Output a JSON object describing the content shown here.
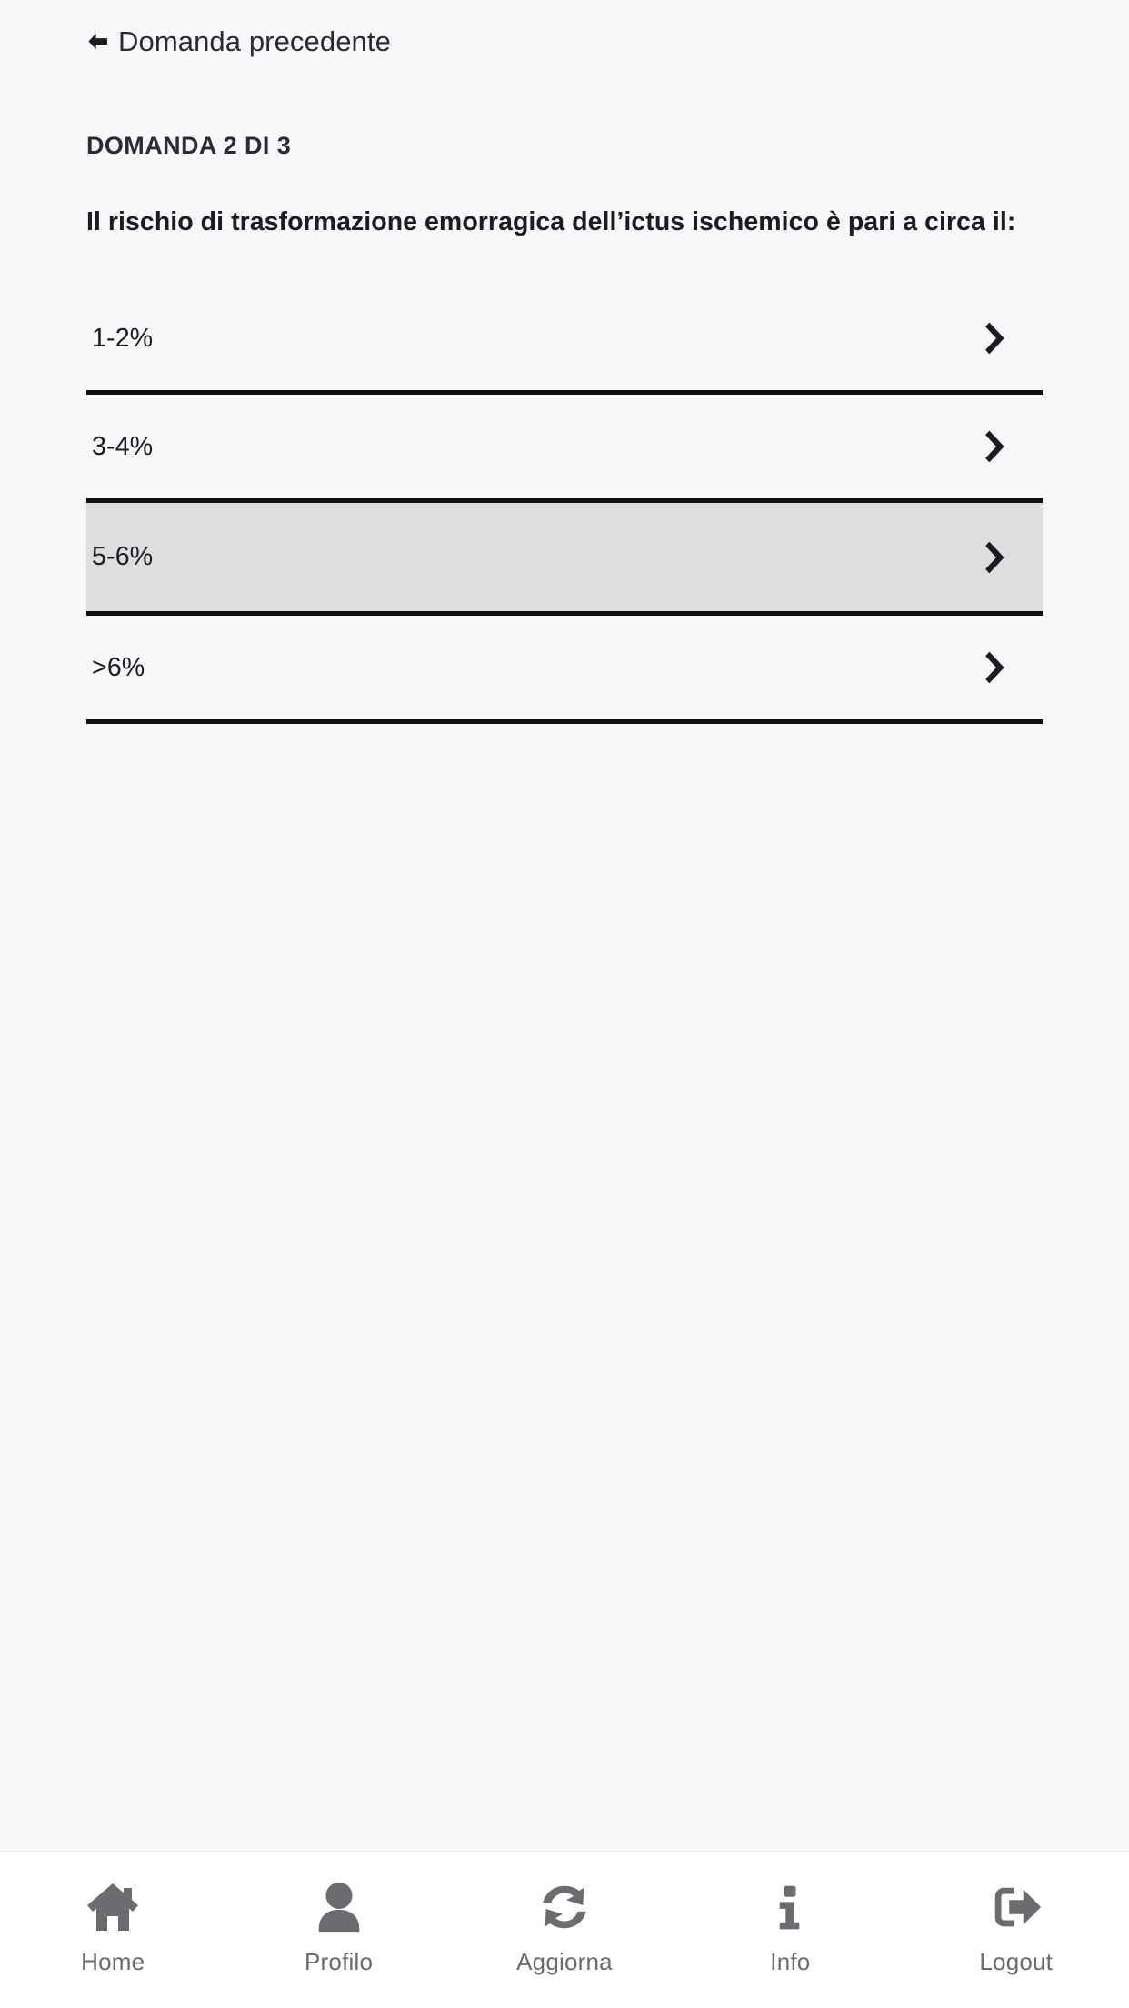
{
  "colors": {
    "page_background": "#f8f7fa",
    "nav_background": "#ffffff",
    "text_primary": "#1c1c20",
    "selected_row_background": "#dedde0",
    "row_border": "#111114",
    "nav_icon": "#6b6b70",
    "nav_label": "#6b6b70"
  },
  "back": {
    "label": "Domanda precedente",
    "icon": "arrow-left-icon"
  },
  "question": {
    "counter": "DOMANDA 2 DI 3",
    "text": "Il rischio di trasformazione emorragica dell’ictus ischemico è pari a circa il:"
  },
  "answers": [
    {
      "label": "1-2%",
      "selected": false,
      "chevron": "chevron-right-icon"
    },
    {
      "label": "3-4%",
      "selected": false,
      "chevron": "chevron-right-icon"
    },
    {
      "label": "5-6%",
      "selected": true,
      "chevron": "chevron-right-icon"
    },
    {
      "label": ">6%",
      "selected": false,
      "chevron": "chevron-right-icon"
    }
  ],
  "bottom_nav": [
    {
      "label": "Home",
      "icon": "home-icon"
    },
    {
      "label": "Profilo",
      "icon": "user-icon"
    },
    {
      "label": "Aggiorna",
      "icon": "refresh-icon"
    },
    {
      "label": "Info",
      "icon": "info-icon"
    },
    {
      "label": "Logout",
      "icon": "logout-icon"
    }
  ]
}
